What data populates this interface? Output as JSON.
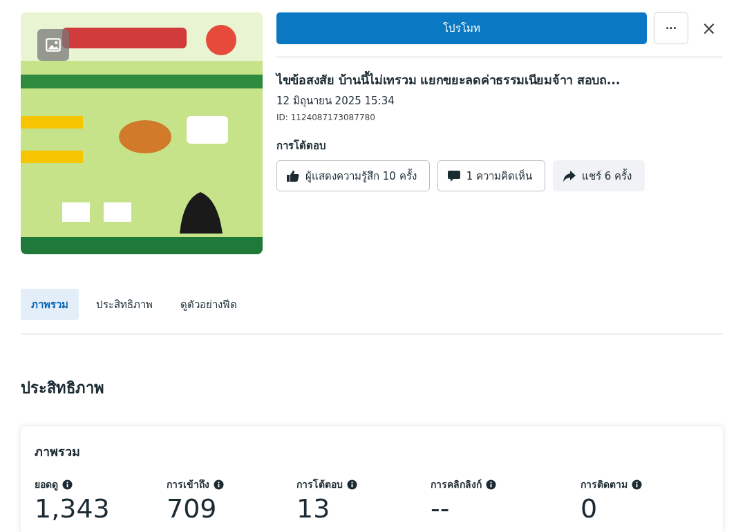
{
  "post": {
    "title": "ไขข้อสงสัย บ้านนี้ไม่เทรวม แยกขยะลดค่าธรรมเนียมจ้าา สอบถ...",
    "date": "12 มิถุนายน 2025 15:34",
    "id": "ID: 1124087173087780"
  },
  "actions": {
    "promote": "โปรโมท",
    "more": "···",
    "close": "×"
  },
  "interactions": {
    "heading": "การโต้ตอบ",
    "buttons": [
      {
        "kind": "like",
        "label": "ผู้แสดงความรู้สึก 10 ครั้ง",
        "filled": false
      },
      {
        "kind": "comment",
        "label": "1 ความคิดเห็น",
        "filled": false
      },
      {
        "kind": "share",
        "label": "แชร์ 6 ครั้ง",
        "filled": true
      }
    ]
  },
  "tabs": [
    {
      "label": "ภาพรวม",
      "selected": true
    },
    {
      "label": "ประสิทธิภาพ",
      "selected": false
    },
    {
      "label": "ดูตัวอย่างฟีด",
      "selected": false
    }
  ],
  "section_title": "ประสิทธิภาพ",
  "overview": {
    "title": "ภาพรวม",
    "metrics": [
      {
        "label": "ยอดดู",
        "value": "1,343"
      },
      {
        "label": "การเข้าถึง",
        "value": "709"
      },
      {
        "label": "การโต้ตอบ",
        "value": "13"
      },
      {
        "label": "การคลิกลิงก์",
        "value": "--"
      },
      {
        "label": "การติดตาม",
        "value": "0"
      }
    ]
  }
}
